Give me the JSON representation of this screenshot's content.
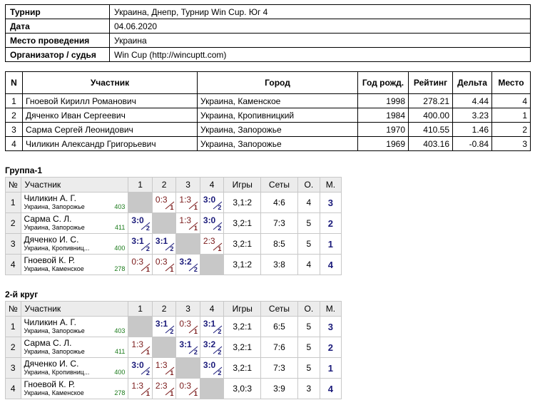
{
  "info": [
    {
      "label": "Турнир",
      "value": "Украина, Днепр, Турнир Win Cup. Юг 4"
    },
    {
      "label": "Дата",
      "value": "04.06.2020"
    },
    {
      "label": "Место проведения",
      "value": "Украина"
    },
    {
      "label": "Организатор / судья",
      "value": "Win Cup (http://wincuptt.com)"
    }
  ],
  "participants": {
    "headers": [
      "N",
      "Участник",
      "Город",
      "Год рожд.",
      "Рейтинг",
      "Дельта",
      "Место"
    ],
    "rows": [
      [
        "1",
        "Гноевой Кирилл Романович",
        "Украина, Каменское",
        "1998",
        "278.21",
        "4.44",
        "4"
      ],
      [
        "2",
        "Дяченко Иван Сергеевич",
        "Украина, Кропивницкий",
        "1984",
        "400.00",
        "3.23",
        "1"
      ],
      [
        "3",
        "Сарма Сергей Леонидович",
        "Украина, Запорожье",
        "1970",
        "410.55",
        "1.46",
        "2"
      ],
      [
        "4",
        "Чиликин Александр Григорьевич",
        "Украина, Запорожье",
        "1969",
        "403.16",
        "-0.84",
        "3"
      ]
    ]
  },
  "group_headers": [
    "№",
    "Участник",
    "1",
    "2",
    "3",
    "4",
    "Игры",
    "Сеты",
    "О.",
    "М."
  ],
  "groups": [
    {
      "title": "Группа-1",
      "rows": [
        {
          "n": "1",
          "name": "Чиликин А. Г.",
          "city": "Украина, Запорожье",
          "rating": "403",
          "cells": [
            null,
            {
              "s": "0:3",
              "p": "1",
              "w": false
            },
            {
              "s": "1:3",
              "p": "1",
              "w": false
            },
            {
              "s": "3:0",
              "p": "2",
              "w": true
            }
          ],
          "games": "3,1:2",
          "sets": "4:6",
          "pts": "4",
          "place": "3"
        },
        {
          "n": "2",
          "name": "Сарма С. Л.",
          "city": "Украина, Запорожье",
          "rating": "411",
          "cells": [
            {
              "s": "3:0",
              "p": "2",
              "w": true
            },
            null,
            {
              "s": "1:3",
              "p": "1",
              "w": false
            },
            {
              "s": "3:0",
              "p": "2",
              "w": true
            }
          ],
          "games": "3,2:1",
          "sets": "7:3",
          "pts": "5",
          "place": "2"
        },
        {
          "n": "3",
          "name": "Дяченко И. С.",
          "city": "Украина, Кропивниц...",
          "rating": "400",
          "cells": [
            {
              "s": "3:1",
              "p": "2",
              "w": true
            },
            {
              "s": "3:1",
              "p": "2",
              "w": true
            },
            null,
            {
              "s": "2:3",
              "p": "1",
              "w": false
            }
          ],
          "games": "3,2:1",
          "sets": "8:5",
          "pts": "5",
          "place": "1"
        },
        {
          "n": "4",
          "name": "Гноевой К. Р.",
          "city": "Украина, Каменское",
          "rating": "278",
          "cells": [
            {
              "s": "0:3",
              "p": "1",
              "w": false
            },
            {
              "s": "0:3",
              "p": "1",
              "w": false
            },
            {
              "s": "3:2",
              "p": "2",
              "w": true
            },
            null
          ],
          "games": "3,1:2",
          "sets": "3:8",
          "pts": "4",
          "place": "4"
        }
      ]
    },
    {
      "title": "2-й круг",
      "rows": [
        {
          "n": "1",
          "name": "Чиликин А. Г.",
          "city": "Украина, Запорожье",
          "rating": "403",
          "cells": [
            null,
            {
              "s": "3:1",
              "p": "2",
              "w": true
            },
            {
              "s": "0:3",
              "p": "1",
              "w": false
            },
            {
              "s": "3:1",
              "p": "2",
              "w": true
            }
          ],
          "games": "3,2:1",
          "sets": "6:5",
          "pts": "5",
          "place": "3"
        },
        {
          "n": "2",
          "name": "Сарма С. Л.",
          "city": "Украина, Запорожье",
          "rating": "411",
          "cells": [
            {
              "s": "1:3",
              "p": "1",
              "w": false
            },
            null,
            {
              "s": "3:1",
              "p": "2",
              "w": true
            },
            {
              "s": "3:2",
              "p": "2",
              "w": true
            }
          ],
          "games": "3,2:1",
          "sets": "7:6",
          "pts": "5",
          "place": "2"
        },
        {
          "n": "3",
          "name": "Дяченко И. С.",
          "city": "Украина, Кропивниц...",
          "rating": "400",
          "cells": [
            {
              "s": "3:0",
              "p": "2",
              "w": true
            },
            {
              "s": "1:3",
              "p": "1",
              "w": false
            },
            null,
            {
              "s": "3:0",
              "p": "2",
              "w": true
            }
          ],
          "games": "3,2:1",
          "sets": "7:3",
          "pts": "5",
          "place": "1"
        },
        {
          "n": "4",
          "name": "Гноевой К. Р.",
          "city": "Украина, Каменское",
          "rating": "278",
          "cells": [
            {
              "s": "1:3",
              "p": "1",
              "w": false
            },
            {
              "s": "2:3",
              "p": "1",
              "w": false
            },
            {
              "s": "0:3",
              "p": "1",
              "w": false
            },
            null
          ],
          "games": "3,0:3",
          "sets": "3:9",
          "pts": "3",
          "place": "4"
        }
      ]
    }
  ],
  "colors": {
    "win": "#1a1a7a",
    "loss": "#7a1a1a",
    "rating": "#1a7a1a",
    "header_bg": "#ececec",
    "self_cell": "#c8c8c8"
  }
}
